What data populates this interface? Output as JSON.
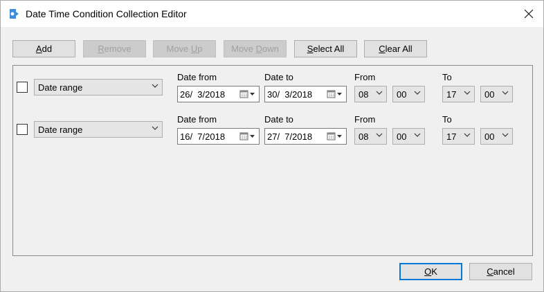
{
  "window": {
    "title": "Date Time Condition Collection Editor"
  },
  "toolbar": {
    "add_label_u": "A",
    "add_label_rest": "dd",
    "remove_label_u": "R",
    "remove_label_rest": "emove",
    "moveup_label_a": "Move ",
    "moveup_label_u": "U",
    "moveup_label_rest": "p",
    "movedown_label_a": "Move ",
    "movedown_label_u": "D",
    "movedown_label_rest": "own",
    "selectall_label_u": "S",
    "selectall_label_rest": "elect All",
    "clearall_label_u": "C",
    "clearall_label_rest": "lear All"
  },
  "rows": [
    {
      "type": "Date range",
      "date_from_label": "Date from",
      "date_from": "26/  3/2018",
      "date_to_label": "Date to",
      "date_to": "30/  3/2018",
      "from_label": "From",
      "from_hour": "08",
      "from_min": "00",
      "to_label": "To",
      "to_hour": "17",
      "to_min": "00"
    },
    {
      "type": "Date range",
      "date_from_label": "Date from",
      "date_from": "16/  7/2018",
      "date_to_label": "Date to",
      "date_to": "27/  7/2018",
      "from_label": "From",
      "from_hour": "08",
      "from_min": "00",
      "to_label": "To",
      "to_hour": "17",
      "to_min": "00"
    }
  ],
  "footer": {
    "ok_label_u": "O",
    "ok_label_rest": "K",
    "cancel_label_u": "C",
    "cancel_label_rest": "ancel"
  }
}
